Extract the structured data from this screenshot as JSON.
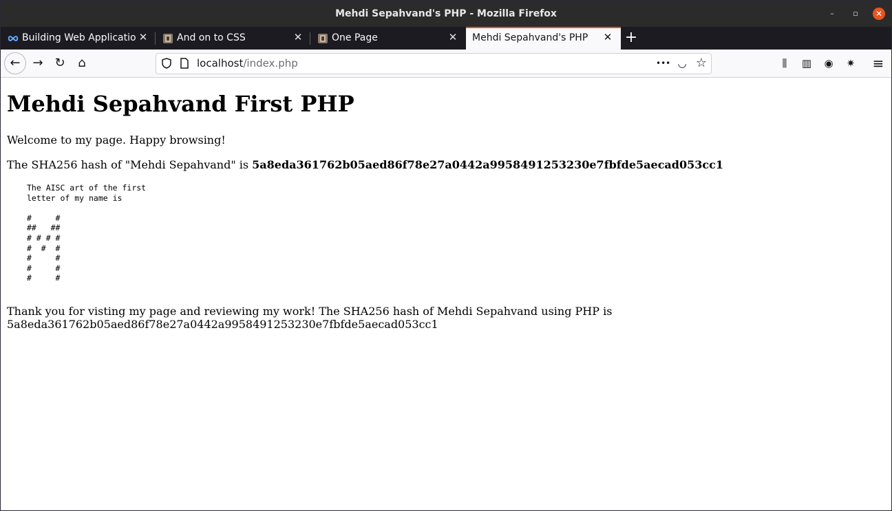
{
  "window": {
    "title": "Mehdi Sepahvand's PHP - Mozilla Firefox",
    "min_glyph": "–",
    "max_glyph": "▫",
    "close_glyph": "✕"
  },
  "tabs": [
    {
      "label": "Building Web Application",
      "icon": "infinity-icon",
      "active": false
    },
    {
      "label": "And on to CSS",
      "icon": "favicon",
      "active": false
    },
    {
      "label": "One Page",
      "icon": "favicon",
      "active": false
    },
    {
      "label": "Mehdi Sepahvand's PHP",
      "icon": "none",
      "active": true
    }
  ],
  "tab_close_glyph": "✕",
  "new_tab_glyph": "+",
  "navbar": {
    "back_glyph": "←",
    "forward_glyph": "→",
    "reload_glyph": "↻",
    "home_glyph": "⌂",
    "url_host": "localhost",
    "url_path": "/index.php",
    "more_glyph": "•••",
    "pocket_glyph": "◡",
    "bookmark_glyph": "☆",
    "library_glyph": "⫼",
    "sidebar_glyph": "▥",
    "account_glyph": "◉",
    "extension_glyph": "✷",
    "menu_glyph": "≡"
  },
  "page": {
    "heading": "Mehdi Sepahvand First PHP",
    "welcome": "Welcome to my page. Happy browsing!",
    "hash_prefix": "The SHA256 hash of \"Mehdi Sepahvand\" is ",
    "hash_value": "5a8eda361762b05aed86f78e27a0442a9958491253230e7fbfde5aecad053cc1",
    "ascii_art": "The AISC art of the first\nletter of my name is\n\n#     #\n##   ##\n# # # #\n#  #  #\n#     #\n#     #\n#     #",
    "thanks": "Thank you for visting my page and reviewing my work! The SHA256 hash of Mehdi Sepahvand using PHP is 5a8eda361762b05aed86f78e27a0442a9958491253230e7fbfde5aecad053cc1"
  },
  "colors": {
    "titlebar": "#2b2b2b",
    "tabstrip": "#1c1b22",
    "active_tab": "#f9f9fb",
    "accent": "#e95420"
  }
}
